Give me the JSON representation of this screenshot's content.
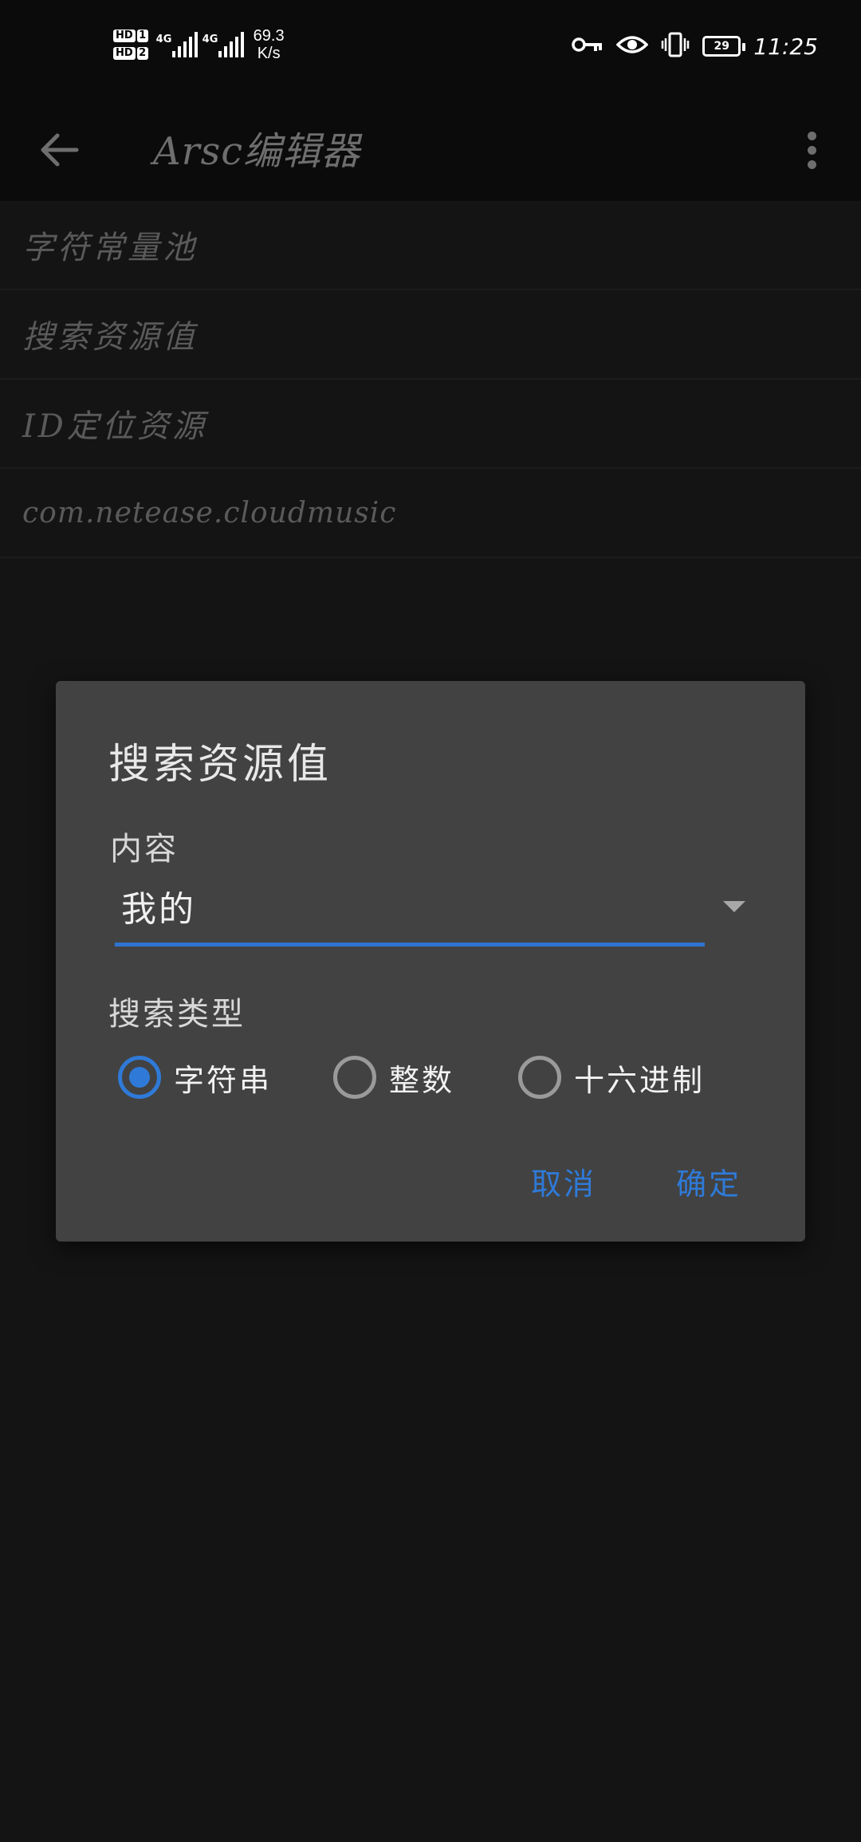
{
  "status_bar": {
    "sim1_label": "HD",
    "sim1_number": "1",
    "sim2_label": "HD",
    "sim2_number": "2",
    "net1_type": "4G",
    "net2_type": "4G",
    "speed_value": "69.3",
    "speed_unit": "K/s",
    "battery_level": "29",
    "time": "11:25",
    "icons": [
      "key-icon",
      "eye-icon",
      "vibrate-icon",
      "battery-icon"
    ]
  },
  "toolbar": {
    "title": "Arsc编辑器",
    "back_icon": "arrow-left-icon",
    "menu_icon": "more-vert-icon"
  },
  "list": {
    "items": [
      {
        "label": "字符常量池"
      },
      {
        "label": "搜索资源值"
      },
      {
        "label": "ID定位资源"
      },
      {
        "label": "com.netease.cloudmusic"
      }
    ]
  },
  "dialog": {
    "title": "搜索资源值",
    "content_label": "内容",
    "content_value": "我的",
    "search_type_label": "搜索类型",
    "search_types": [
      {
        "label": "字符串",
        "checked": true
      },
      {
        "label": "整数",
        "checked": false
      },
      {
        "label": "十六进制",
        "checked": false
      }
    ],
    "cancel_label": "取消",
    "ok_label": "确定"
  },
  "colors": {
    "accent": "#2f7ad8",
    "dialog_bg": "#424242",
    "screen_bg": "#141414"
  }
}
